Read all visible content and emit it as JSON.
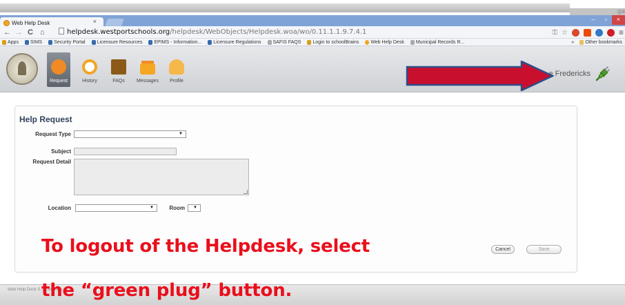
{
  "browser": {
    "corner_text": "ga",
    "tab_title": "Web Help Desk",
    "tab_close": "×",
    "window_controls": {
      "minimize": "–",
      "restore": "▫",
      "close": "×"
    },
    "nav": {
      "back": "←",
      "forward": "→",
      "reload": "C",
      "home": "⌂"
    },
    "url_host": "helpdesk.westportschools.org",
    "url_path": "/helpdesk/WebObjects/Helpdesk.woa/wo/0.11.1.1.9.7.4.1",
    "omni_icons": {
      "key": "⚿",
      "star": "☆",
      "menu": "≡"
    },
    "bookmarks": [
      {
        "label": "Apps",
        "icon": "apps-grid"
      },
      {
        "label": "SIMS",
        "icon": "shield"
      },
      {
        "label": "Security Portal",
        "icon": "shield"
      },
      {
        "label": "Licensure Resources",
        "icon": "shield"
      },
      {
        "label": "EPIMS - Information...",
        "icon": "shield"
      },
      {
        "label": "Licensure Regulations",
        "icon": "shield"
      },
      {
        "label": "SAFIS FAQS",
        "icon": "globe"
      },
      {
        "label": "Login to schoolBrains",
        "icon": "school"
      },
      {
        "label": "Web Help Desk",
        "icon": "helpdesk"
      },
      {
        "label": "Municipal Records R...",
        "icon": "doc"
      }
    ],
    "bookmarks_overflow": "»",
    "other_bookmarks": "Other bookmarks"
  },
  "app": {
    "nav": [
      {
        "label": "Request",
        "icon": "request-icon",
        "active": true
      },
      {
        "label": "History",
        "icon": "history-icon",
        "active": false
      },
      {
        "label": "FAQs",
        "icon": "faq-icon",
        "active": false
      },
      {
        "label": "Messages",
        "icon": "messages-icon",
        "active": false
      },
      {
        "label": "Profile",
        "icon": "profile-icon",
        "active": false
      }
    ],
    "user_name": "e Fredericks",
    "logout_icon": "green-plug-icon"
  },
  "form": {
    "title": "Help Request",
    "request_type_label": "Request Type",
    "request_type_value": "▼",
    "subject_label": "Subject",
    "subject_value": "",
    "detail_label": "Request Detail",
    "location_label": "Location",
    "location_value": "▼",
    "room_label": "Room",
    "room_value": "▼",
    "cancel_label": "Cancel",
    "save_label": "Save"
  },
  "footer": {
    "text": "Web Help Desk S... ...erWods ..."
  },
  "caption": {
    "line1": "To logout of the Helpdesk, select",
    "line2": "the “green plug” button."
  },
  "colors": {
    "caption": "#ea0f1c",
    "arrow_fill": "#c8102e",
    "arrow_outline": "#2e4d8a",
    "plug": "#4c9a2a"
  }
}
